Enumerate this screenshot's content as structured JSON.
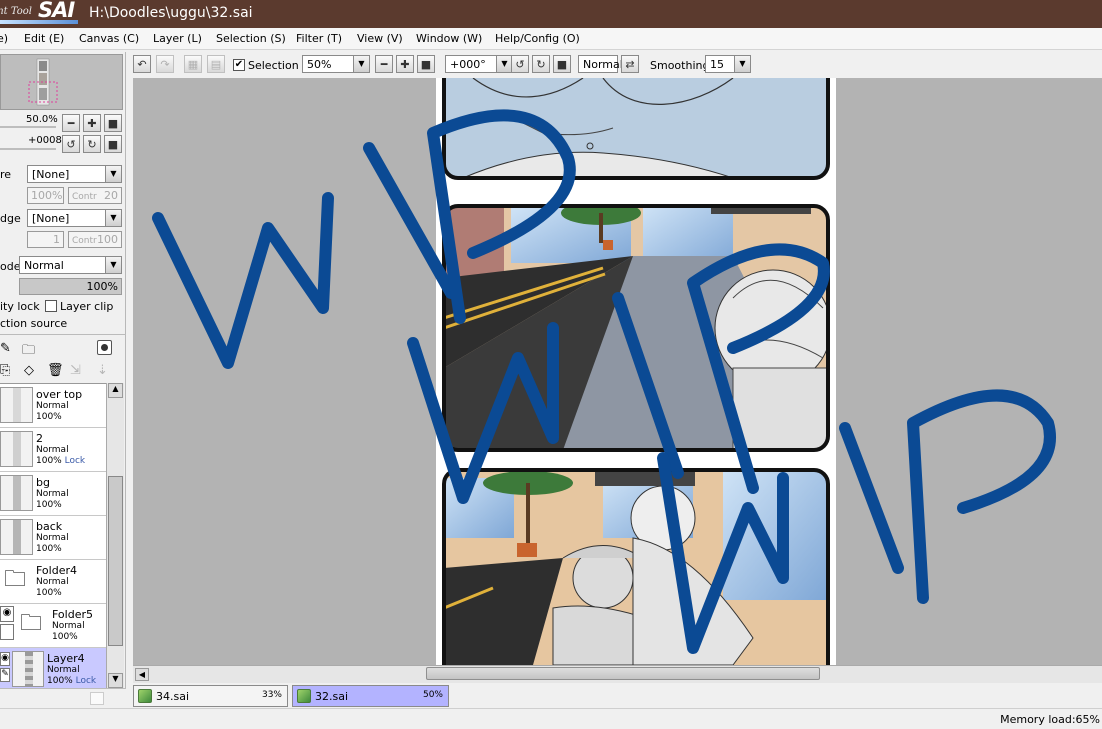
{
  "titlebar": {
    "logo_small": "int Tool",
    "logo_big": "SAI",
    "path": "H:\\Doodles\\uggu\\32.sai"
  },
  "menu": [
    {
      "label": "e)"
    },
    {
      "label": "Edit (E)"
    },
    {
      "label": "Canvas (C)"
    },
    {
      "label": "Layer (L)"
    },
    {
      "label": "Selection (S)"
    },
    {
      "label": "Filter (T)"
    },
    {
      "label": "View (V)"
    },
    {
      "label": "Window (W)"
    },
    {
      "label": "Help/Config (O)"
    }
  ],
  "toolbar": {
    "selection_label": "Selection",
    "selection_checked": "✔",
    "zoom_value": "50%",
    "rotation_value": "+000°",
    "blend_value": "Normal",
    "smoothing_label": "Smoothing",
    "smoothing_value": "15"
  },
  "navigator": {
    "zoom": "50.0%",
    "rotation": "+0008"
  },
  "panel": {
    "texture_label": "re",
    "texture_value": "[None]",
    "texture_scale": "100%",
    "texture_contr_label": "Contr",
    "texture_contr": "20",
    "edge_label": "dge",
    "edge_value": "[None]",
    "edge_width": "1",
    "edge_contr_label": "Contr",
    "edge_contr": "100",
    "mode_label": "ode",
    "mode_value": "Normal",
    "opacity_value": "100%",
    "opacity_lock_label": "ity lock",
    "layer_clip_label": "Layer clip",
    "selection_source_label": "ction source"
  },
  "layers": [
    {
      "name": "over top",
      "mode": "Normal",
      "opacity": "100%",
      "lock": ""
    },
    {
      "name": "2",
      "mode": "Normal",
      "opacity": "100%",
      "lock": "Lock"
    },
    {
      "name": "bg",
      "mode": "Normal",
      "opacity": "100%",
      "lock": ""
    },
    {
      "name": "back",
      "mode": "Normal",
      "opacity": "100%",
      "lock": ""
    },
    {
      "name": "Folder4",
      "mode": "Normal",
      "opacity": "100%",
      "lock": ""
    },
    {
      "name": "Folder5",
      "mode": "Normal",
      "opacity": "100%",
      "lock": ""
    },
    {
      "name": "Layer4",
      "mode": "Normal",
      "opacity": "100%",
      "lock": "Lock"
    }
  ],
  "canvas": {
    "watermark": "WIP"
  },
  "file_tabs": [
    {
      "name": "34.sai",
      "zoom": "33%"
    },
    {
      "name": "32.sai",
      "zoom": "50%"
    }
  ],
  "status": {
    "memory_load": "Memory load:65%"
  },
  "colors": {
    "titlebar": "#5b3a2e",
    "watermark": "#0b4a94",
    "selected_layer": "#c9c9ff",
    "active_tab": "#b3b3ff"
  },
  "icons": {
    "undo": "undo-icon",
    "redo": "redo-icon",
    "zoom_out": "minus-icon",
    "zoom_in": "plus-icon",
    "reset": "square-icon",
    "rotate_ccw": "rotate-ccw-icon",
    "rotate_cw": "rotate-cw-icon",
    "flip": "flip-icon"
  }
}
